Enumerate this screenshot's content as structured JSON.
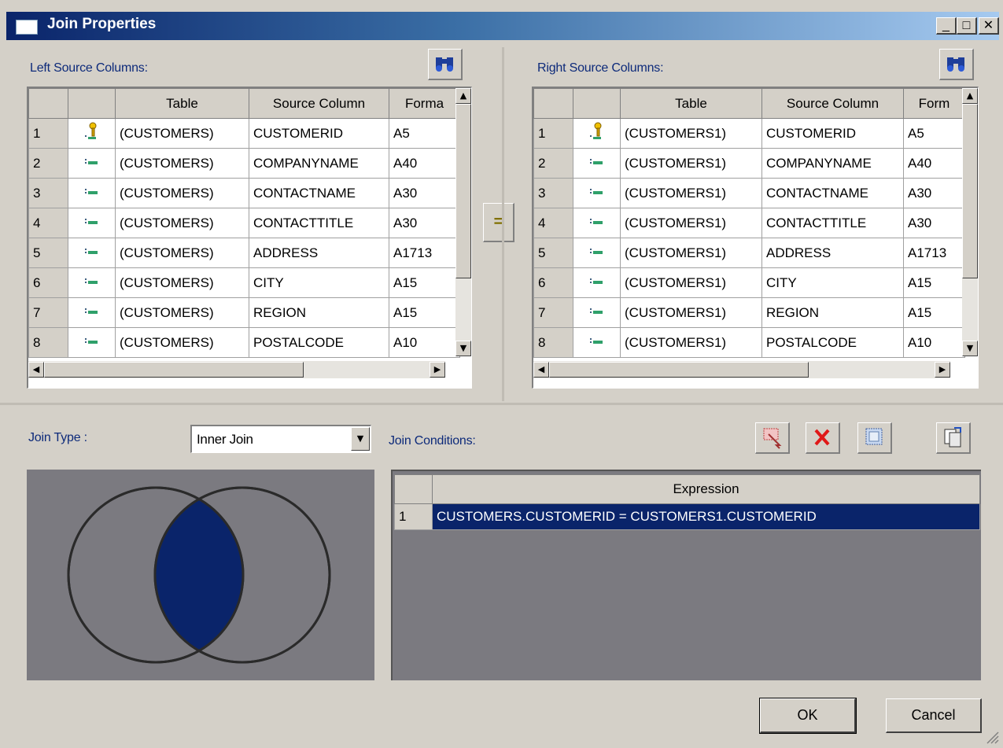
{
  "window": {
    "title": "Join Properties",
    "minimize": "_",
    "maximize": "□",
    "close": "✕"
  },
  "left": {
    "label": "Left Source Columns:",
    "headers": [
      "",
      "",
      "Table",
      "Source Column",
      "Forma"
    ],
    "rows": [
      {
        "n": "1",
        "icon": "key-icon",
        "table": "(CUSTOMERS)",
        "column": "CUSTOMERID",
        "format": "A5"
      },
      {
        "n": "2",
        "icon": "field-icon",
        "table": "(CUSTOMERS)",
        "column": "COMPANYNAME",
        "format": "A40"
      },
      {
        "n": "3",
        "icon": "field-icon",
        "table": "(CUSTOMERS)",
        "column": "CONTACTNAME",
        "format": "A30"
      },
      {
        "n": "4",
        "icon": "field-icon",
        "table": "(CUSTOMERS)",
        "column": "CONTACTTITLE",
        "format": "A30"
      },
      {
        "n": "5",
        "icon": "field-icon",
        "table": "(CUSTOMERS)",
        "column": "ADDRESS",
        "format": "A1713"
      },
      {
        "n": "6",
        "icon": "field-icon",
        "table": "(CUSTOMERS)",
        "column": "CITY",
        "format": "A15"
      },
      {
        "n": "7",
        "icon": "field-icon",
        "table": "(CUSTOMERS)",
        "column": "REGION",
        "format": "A15"
      },
      {
        "n": "8",
        "icon": "field-icon",
        "table": "(CUSTOMERS)",
        "column": "POSTALCODE",
        "format": "A10"
      }
    ]
  },
  "right": {
    "label": "Right Source Columns:",
    "headers": [
      "",
      "",
      "Table",
      "Source Column",
      "Form"
    ],
    "rows": [
      {
        "n": "1",
        "icon": "key-icon",
        "table": "(CUSTOMERS1)",
        "column": "CUSTOMERID",
        "format": "A5"
      },
      {
        "n": "2",
        "icon": "field-icon",
        "table": "(CUSTOMERS1)",
        "column": "COMPANYNAME",
        "format": "A40"
      },
      {
        "n": "3",
        "icon": "field-icon",
        "table": "(CUSTOMERS1)",
        "column": "CONTACTNAME",
        "format": "A30"
      },
      {
        "n": "4",
        "icon": "field-icon",
        "table": "(CUSTOMERS1)",
        "column": "CONTACTTITLE",
        "format": "A30"
      },
      {
        "n": "5",
        "icon": "field-icon",
        "table": "(CUSTOMERS1)",
        "column": "ADDRESS",
        "format": "A1713"
      },
      {
        "n": "6",
        "icon": "field-icon",
        "table": "(CUSTOMERS1)",
        "column": "CITY",
        "format": "A15"
      },
      {
        "n": "7",
        "icon": "field-icon",
        "table": "(CUSTOMERS1)",
        "column": "REGION",
        "format": "A15"
      },
      {
        "n": "8",
        "icon": "field-icon",
        "table": "(CUSTOMERS1)",
        "column": "POSTALCODE",
        "format": "A10"
      }
    ]
  },
  "equals_label": "=",
  "join_type": {
    "label": "Join Type :",
    "value": "Inner Join"
  },
  "join_conditions": {
    "label": "Join Conditions:",
    "headers": [
      "",
      "Expression"
    ],
    "rows": [
      {
        "n": "1",
        "expression": "CUSTOMERS.CUSTOMERID = CUSTOMERS1.CUSTOMERID"
      }
    ]
  },
  "buttons": {
    "ok": "OK",
    "cancel": "Cancel"
  },
  "colors": {
    "selection": "#0a246a",
    "label_text": "#0d2a7a",
    "panel_bg": "#d4d0c8",
    "venn_bg": "#7b7a80"
  }
}
